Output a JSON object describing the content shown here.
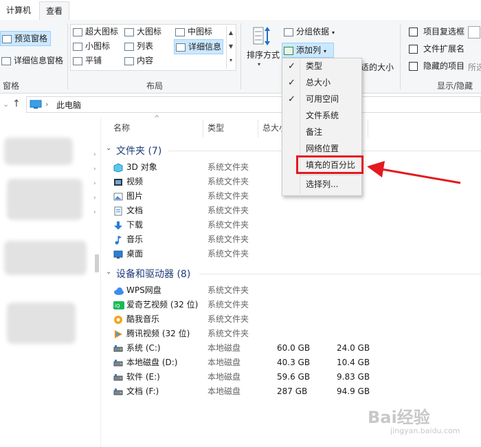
{
  "tabs": [
    "计算机",
    "查看"
  ],
  "ribbon": {
    "panes": {
      "preview": "预览窗格",
      "details": "详细信息窗格",
      "group_label": "窗格"
    },
    "layout": {
      "items": [
        "超大图标",
        "大图标",
        "中图标",
        "小图标",
        "列表",
        "详细信息",
        "平铺",
        "内容"
      ],
      "selected": "详细信息",
      "group_label": "布局"
    },
    "current_view": {
      "sort_by": "排序方式",
      "group_by": "分组依据",
      "add_columns": "添加列",
      "fit_columns_partial": "适的大小"
    },
    "show_hide": {
      "item_checkboxes": "项目复选框",
      "file_ext": "文件扩展名",
      "hidden_items": "隐藏的项目",
      "partial": "所选",
      "group_label": "显示/隐藏"
    }
  },
  "address": {
    "location": "此电脑"
  },
  "columns": {
    "name": "名称",
    "type": "类型",
    "total_size": "总大小"
  },
  "folders_group": {
    "title": "文件夹",
    "count": "(7)"
  },
  "folders": [
    {
      "name": "3D 对象",
      "type": "系统文件夹",
      "icon": "3d-objects-icon"
    },
    {
      "name": "视频",
      "type": "系统文件夹",
      "icon": "video-icon"
    },
    {
      "name": "图片",
      "type": "系统文件夹",
      "icon": "pictures-icon"
    },
    {
      "name": "文档",
      "type": "系统文件夹",
      "icon": "documents-icon"
    },
    {
      "name": "下载",
      "type": "系统文件夹",
      "icon": "download-icon"
    },
    {
      "name": "音乐",
      "type": "系统文件夹",
      "icon": "music-icon"
    },
    {
      "name": "桌面",
      "type": "系统文件夹",
      "icon": "desktop-icon"
    }
  ],
  "drives_group": {
    "title": "设备和驱动器",
    "count": "(8)"
  },
  "drives": [
    {
      "name": "WPS网盘",
      "type": "系统文件夹",
      "total": "",
      "free": "",
      "icon": "cloud-icon"
    },
    {
      "name": "爱奇艺视频 (32 位)",
      "type": "系统文件夹",
      "total": "",
      "free": "",
      "icon": "iqiyi-icon"
    },
    {
      "name": "酷我音乐",
      "type": "系统文件夹",
      "total": "",
      "free": "",
      "icon": "kuwo-icon"
    },
    {
      "name": "腾讯视频 (32 位)",
      "type": "系统文件夹",
      "total": "",
      "free": "",
      "icon": "tencent-video-icon"
    },
    {
      "name": "系统 (C:)",
      "type": "本地磁盘",
      "total": "60.0 GB",
      "free": "24.0 GB",
      "icon": "drive-icon"
    },
    {
      "name": "本地磁盘 (D:)",
      "type": "本地磁盘",
      "total": "40.3 GB",
      "free": "10.4 GB",
      "icon": "drive-icon"
    },
    {
      "name": "软件 (E:)",
      "type": "本地磁盘",
      "total": "59.6 GB",
      "free": "9.83 GB",
      "icon": "drive-icon"
    },
    {
      "name": "文档 (F:)",
      "type": "本地磁盘",
      "total": "287 GB",
      "free": "94.9 GB",
      "icon": "drive-icon"
    }
  ],
  "menu": {
    "items": [
      {
        "label": "类型",
        "checked": true
      },
      {
        "label": "总大小",
        "checked": true
      },
      {
        "label": "可用空间",
        "checked": true
      },
      {
        "label": "文件系统",
        "checked": false
      },
      {
        "label": "备注",
        "checked": false
      },
      {
        "label": "网络位置",
        "checked": false
      },
      {
        "label": "填充的百分比",
        "checked": false
      }
    ],
    "choose_columns": "选择列...",
    "check_mark": "✓"
  },
  "watermark": {
    "brand": "Bai经验",
    "url": "jingyan.baidu.com"
  },
  "colors": {
    "highlight": "#e3191f",
    "selection": "#cce8ff",
    "group_header": "#1e3c78"
  }
}
